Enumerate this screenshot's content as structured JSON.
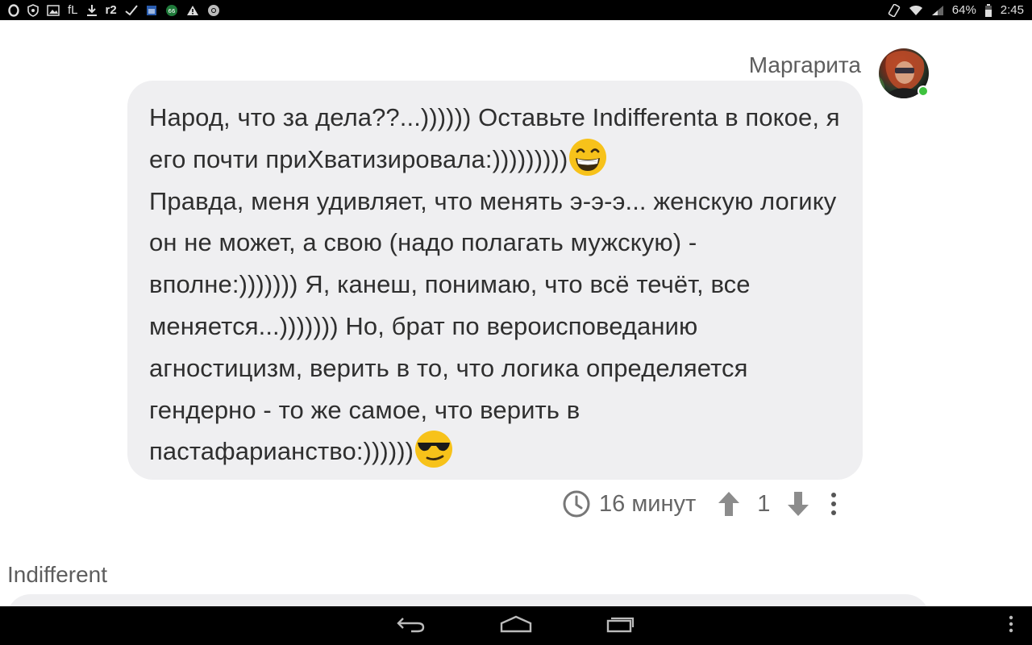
{
  "status_bar": {
    "left_icons": [
      "opera-icon",
      "shield-icon",
      "image-icon",
      "fl-icon",
      "download-icon",
      "r2-icon",
      "check-icon",
      "calendar-icon",
      "badge-66-icon",
      "warning-icon",
      "chrome-icon"
    ],
    "fl_text": "fL",
    "r2_text": "r2",
    "battery": "64%",
    "time": "2:45"
  },
  "comment": {
    "author": "Маргарита",
    "online": true,
    "text_parts": {
      "p1": "Народ, что за дела??...)))))) Оставьте Indifferenta в покое, я его почти приХватизировала:)))))))))",
      "p2": "Правда, меня удивляет, что менять э-э-э... женскую логику он не может, а свою (надо полагать мужскую) - вполне:))))))) Я, канеш, понимаю, что всё течёт, все меняется...))))))) Но, брат по вероисповеданию агностицизм, верить в то, что логика определяется гендерно - то же самое, что верить в пастафарианство:))))))"
    },
    "time_ago": "16 минут",
    "votes": "1"
  },
  "next_comment": {
    "author": "Indifferent"
  },
  "colors": {
    "bubble": "#efeff1",
    "text": "#2f2f2f",
    "meta": "#666666",
    "online": "#3ec23e"
  }
}
